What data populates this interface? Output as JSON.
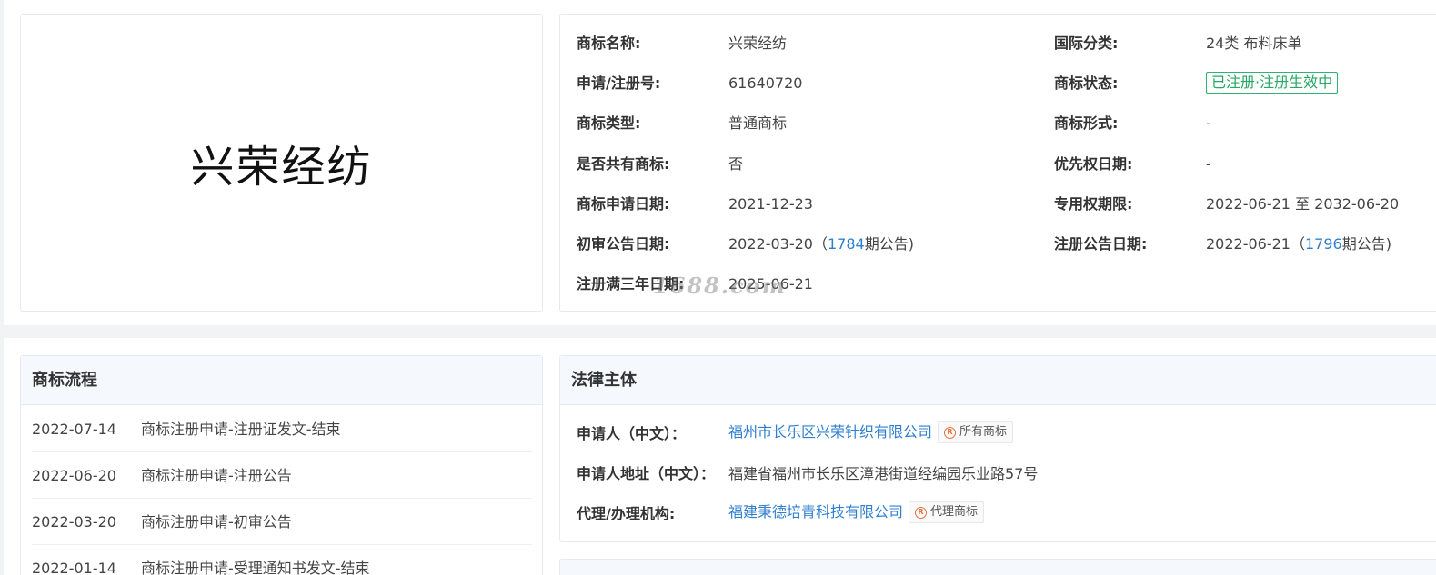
{
  "logo": {
    "text": "兴荣经纺"
  },
  "info": {
    "name_label": "商标名称:",
    "name_value": "兴荣经纺",
    "class_label": "国际分类:",
    "class_value": "24类 布料床单",
    "regno_label": "申请/注册号:",
    "regno_value": "61640720",
    "status_label": "商标状态:",
    "status_value": "已注册·注册生效中",
    "type_label": "商标类型:",
    "type_value": "普通商标",
    "form_label": "商标形式:",
    "form_value": "-",
    "shared_label": "是否共有商标:",
    "shared_value": "否",
    "priority_label": "优先权日期:",
    "priority_value": "-",
    "apply_date_label": "商标申请日期:",
    "apply_date_value": "2021-12-23",
    "exclusive_label": "专用权期限:",
    "exclusive_value": "2022-06-21 至 2032-06-20",
    "prelim_label": "初审公告日期:",
    "prelim_date": "2022-03-20",
    "prelim_paren_open": "（",
    "prelim_issue": "1784",
    "prelim_suffix": "期公告)",
    "reg_notice_label": "注册公告日期:",
    "reg_notice_date": "2022-06-21",
    "reg_notice_paren_open": "（",
    "reg_notice_issue": "1796",
    "reg_notice_suffix": "期公告)",
    "three_year_label": "注册满三年日期:",
    "three_year_value": "2025-06-21"
  },
  "watermark": "1688.com",
  "flow": {
    "title": "商标流程",
    "items": [
      {
        "date": "2022-07-14",
        "desc": "商标注册申请-注册证发文-结束"
      },
      {
        "date": "2022-06-20",
        "desc": "商标注册申请-注册公告"
      },
      {
        "date": "2022-03-20",
        "desc": "商标注册申请-初审公告"
      },
      {
        "date": "2022-01-14",
        "desc": "商标注册申请-受理通知书发文-结束"
      }
    ]
  },
  "legal": {
    "title": "法律主体",
    "applicant_label": "申请人（中文）：",
    "applicant_value": "福州市长乐区兴荣针织有限公司",
    "applicant_badge": "所有商标",
    "address_label": "申请人地址（中文）：",
    "address_value": "福建省福州市长乐区漳港街道经编园乐业路57号",
    "agent_label": "代理/办理机构:",
    "agent_value": "福建秉德培青科技有限公司",
    "agent_badge": "代理商标"
  },
  "colors": {
    "link": "#2f7fd0",
    "status": "#25a862",
    "badge_icon": "#e8703a"
  }
}
